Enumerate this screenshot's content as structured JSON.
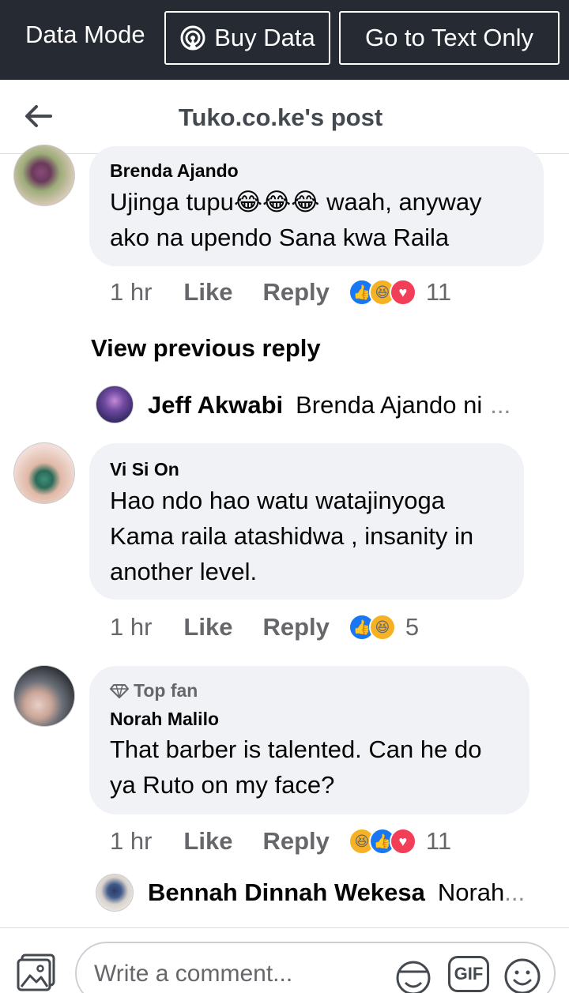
{
  "databar": {
    "mode_label": "Data Mode",
    "buy_label": "Buy Data",
    "text_only_label": "Go to Text Only"
  },
  "header": {
    "title": "Tuko.co.ke's post"
  },
  "comments": [
    {
      "author": "Brenda Ajando",
      "text_line1": "Ujinga tupu😂😂😂 waah, anyway",
      "text_line2": "ako na upendo Sana kwa Raila",
      "time": "1 hr",
      "like": "Like",
      "reply": "Reply",
      "reactions": [
        "like",
        "haha",
        "love"
      ],
      "reaction_count": "11"
    },
    {
      "author": "Vi Si On",
      "text_line1": "Hao ndo hao watu watajinyoga",
      "text_line2": "Kama raila atashidwa , insanity in",
      "text_line3": "another level.",
      "time": "1 hr",
      "like": "Like",
      "reply": "Reply",
      "reactions": [
        "like",
        "haha"
      ],
      "reaction_count": "5"
    },
    {
      "badge": "Top fan",
      "author": "Norah Malilo",
      "text_line1": "That barber is talented. Can he do",
      "text_line2": "ya Ruto on my face?",
      "time": "1 hr",
      "like": "Like",
      "reply": "Reply",
      "reactions": [
        "haha",
        "like",
        "love"
      ],
      "reaction_count": "11"
    }
  ],
  "view_previous": "View previous reply",
  "replies": [
    {
      "author": "Jeff Akwabi",
      "text": "Brenda Ajando ni",
      "ellipsis": "..."
    },
    {
      "author": "Bennah Dinnah Wekesa",
      "text": "Norah",
      "ellipsis": "..."
    }
  ],
  "composer": {
    "placeholder": "Write a comment...",
    "gif_label": "GIF"
  },
  "colors": {
    "databar_bg": "#252a33",
    "bubble_bg": "#f0f2f5",
    "secondary_text": "#65676b",
    "like_blue": "#1877f2",
    "haha_yellow": "#f7b125",
    "love_red": "#f33e58"
  },
  "icons": [
    "back-arrow-icon",
    "broadcast-icon",
    "like-reaction-icon",
    "haha-reaction-icon",
    "love-reaction-icon",
    "diamond-icon",
    "photo-icon",
    "sticker-icon",
    "gif-icon",
    "emoji-icon"
  ]
}
